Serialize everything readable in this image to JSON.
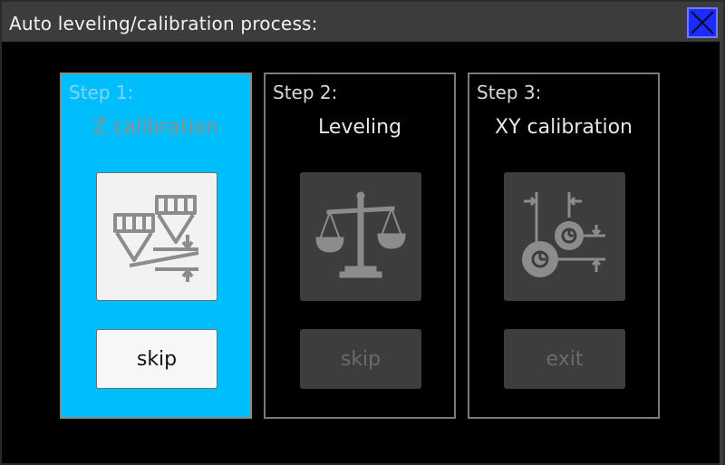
{
  "window": {
    "title": "Auto leveling/calibration process:",
    "close_icon": "close-icon"
  },
  "colors": {
    "active_panel": "#00bdfc",
    "close_button": "#1b2cff",
    "tile_inactive": "#3d3d3d"
  },
  "steps": [
    {
      "label": "Step 1:",
      "name": "Z calibration",
      "icon": "z-calibration-icon",
      "button": "skip",
      "state": "active"
    },
    {
      "label": "Step 2:",
      "name": "Leveling",
      "icon": "balance-scale-icon",
      "button": "skip",
      "state": "inactive"
    },
    {
      "label": "Step 3:",
      "name": "XY calibration",
      "icon": "xy-calibration-icon",
      "button": "exit",
      "state": "inactive"
    }
  ]
}
